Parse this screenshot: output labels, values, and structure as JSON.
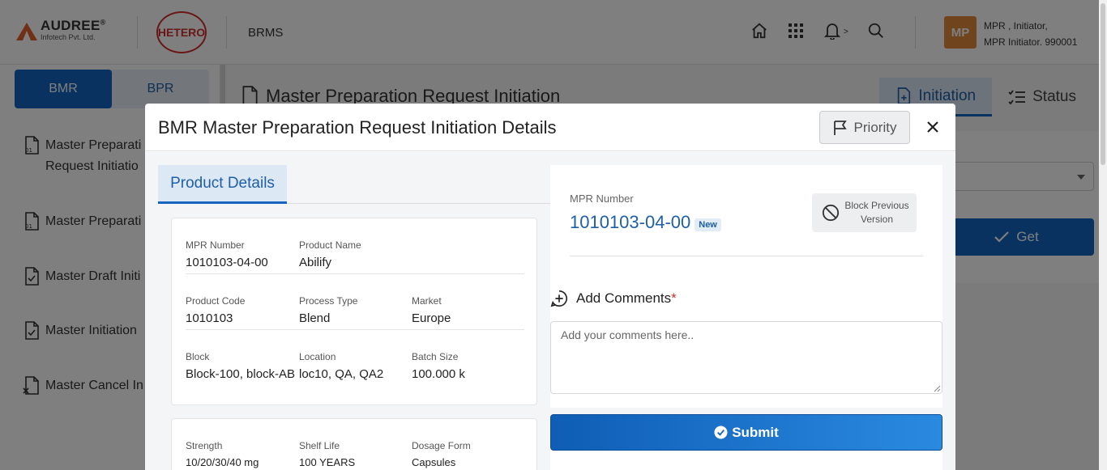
{
  "header": {
    "company_name": "AUDREE",
    "company_reg": "®",
    "company_sub": "Infotech Pvt. Ltd.",
    "partner_logo": "HETERO",
    "app_name": "BRMS",
    "icons": [
      "home-icon",
      "apps-grid-icon",
      "bell-icon",
      "search-icon"
    ],
    "notif_caret": ">",
    "user_initials": "MP",
    "user_line1": "MPR , Initiator,",
    "user_line2": "MPR Initiator. 990001"
  },
  "sidebar": {
    "tabs": [
      {
        "label": "BMR",
        "active": true
      },
      {
        "label": "BPR",
        "active": false
      }
    ],
    "items": [
      {
        "label": "Master Preparati",
        "label2": "Request Initiatio"
      },
      {
        "label": "Master Preparati"
      },
      {
        "label": "Master Draft Initi"
      },
      {
        "label": "Master Initiation"
      },
      {
        "label": "Master Cancel In"
      }
    ]
  },
  "main": {
    "title": "Master Preparation Request Initiation",
    "tabs": [
      {
        "label": "Initiation",
        "active": true
      },
      {
        "label": "Status",
        "active": false
      }
    ],
    "get_label": "Get"
  },
  "modal": {
    "title": "BMR Master Preparation Request Initiation Details",
    "priority_label": "Priority",
    "product_tab": "Product Details",
    "rows": [
      [
        {
          "label": "MPR Number",
          "value": "1010103-04-00"
        },
        {
          "label": "Product Name",
          "value": "Abilify"
        }
      ],
      [
        {
          "label": "Product Code",
          "value": "1010103"
        },
        {
          "label": "Process Type",
          "value": "Blend"
        },
        {
          "label": "Market",
          "value": "Europe"
        }
      ],
      [
        {
          "label": "Block",
          "value": "Block-100, block-AB"
        },
        {
          "label": "Location",
          "value": "loc10, QA, QA2"
        },
        {
          "label": "Batch Size",
          "value": "100.000 k"
        }
      ],
      [
        {
          "label": "Strength",
          "value": "10/20/30/40 mg"
        },
        {
          "label": "Shelf Life",
          "value": "100 YEARS"
        },
        {
          "label": "Dosage Form",
          "value": "Capsules"
        }
      ]
    ],
    "right": {
      "mpr_label": "MPR Number",
      "mpr_value": "1010103-04-00",
      "mpr_badge": "New",
      "block_line1": "Block Previous",
      "block_line2": "Version",
      "comments_label": "Add Comments",
      "required_mark": "*",
      "comments_placeholder": "Add your comments here..",
      "submit_label": "Submit"
    }
  },
  "colors": {
    "primary": "#1565c0",
    "accent_text": "#1f5fa8",
    "avatar": "#e08a3b",
    "required": "#d32f2f",
    "audree_orange": "#e0612a"
  }
}
